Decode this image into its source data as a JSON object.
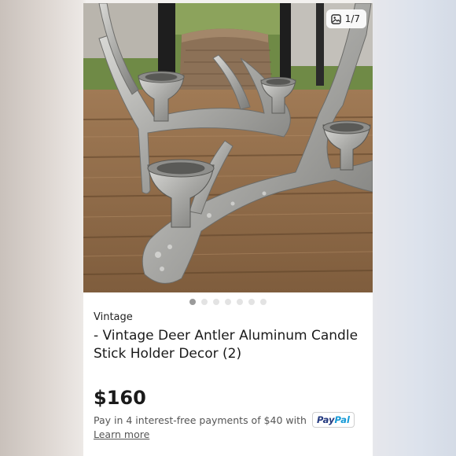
{
  "gallery": {
    "counter_text": "1/7",
    "counter_icon": "image-icon",
    "slide_count": 7,
    "active_slide": 1
  },
  "product": {
    "brand": "Vintage",
    "title": "- Vintage Deer Antler Aluminum Candle Stick Holder Decor (2)",
    "price": "$160"
  },
  "payment": {
    "installment_text": "Pay in 4 interest-free payments of $40 with",
    "paypal_part1": "Pay",
    "paypal_part2": "Pal",
    "learn_more": "Learn more"
  },
  "colors": {
    "paypal_dark": "#253b80",
    "paypal_light": "#179bd7"
  }
}
